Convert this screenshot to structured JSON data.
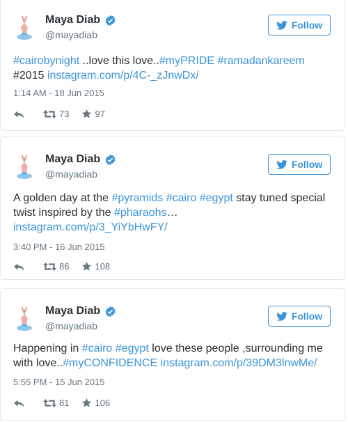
{
  "follow_label": "Follow",
  "colors": {
    "link": "#3b94d9",
    "verified": "#3b94d9",
    "muted": "#66757f"
  },
  "tweets": [
    {
      "name": "Maya Diab",
      "handle": "@mayadiab",
      "line1": [
        "#cairobynight",
        " ..love this love..",
        "#myPRIDE",
        " ",
        "#ramadankareem"
      ],
      "line2": [
        "#2015",
        " ",
        "instagram.com/p/4C-_zJnwDx/"
      ],
      "timestamp": "1:14 AM - 18 Jun 2015",
      "retweets": "73",
      "favorites": "97"
    },
    {
      "name": "Maya Diab",
      "handle": "@mayadiab",
      "line1": [
        "A golden day at the ",
        "#pyramids",
        " ",
        "#cairo",
        " ",
        "#egypt",
        " stay tuned special"
      ],
      "line2": [
        "twist inspired by the ",
        "#pharaohs",
        "…"
      ],
      "line3": [
        "instagram.com/p/3_YiYbHwFY/"
      ],
      "timestamp": "3:40 PM - 16 Jun 2015",
      "retweets": "86",
      "favorites": "108"
    },
    {
      "name": "Maya Diab",
      "handle": "@mayadiab",
      "line1": [
        "Happening in ",
        "#cairo",
        " ",
        "#egypt",
        " love these people ,surrounding me"
      ],
      "line2": [
        "with love..",
        "#myCONFIDENCE",
        " ",
        "instagram.com/p/39DM3lnwMe/"
      ],
      "timestamp": "5:55 PM - 15 Jun 2015",
      "retweets": "81",
      "favorites": "106"
    }
  ]
}
